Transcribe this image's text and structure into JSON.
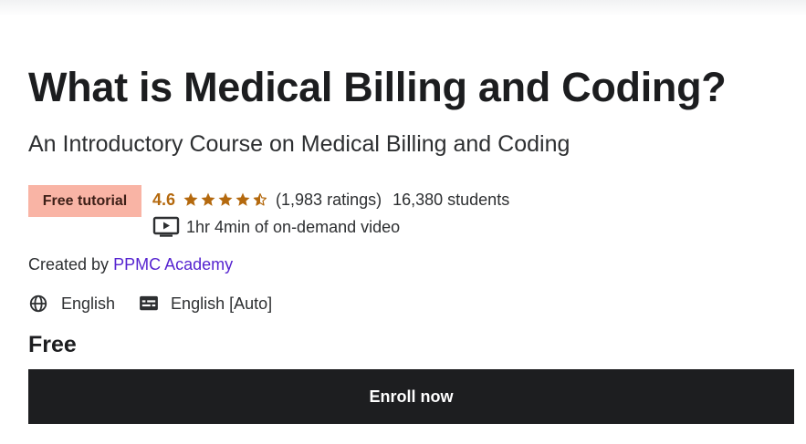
{
  "course": {
    "title": "What is Medical Billing and Coding?",
    "subtitle": "An Introductory Course on Medical Billing and Coding",
    "badge": "Free tutorial",
    "rating": "4.6",
    "rating_stars": 4.6,
    "ratings_count": "(1,983 ratings)",
    "students": "16,380 students",
    "video_length": "1hr 4min of on-demand video"
  },
  "creator": {
    "prefix": "Created by",
    "name": "PPMC Academy"
  },
  "languages": {
    "audio": "English",
    "captions": "English [Auto]"
  },
  "purchase": {
    "price": "Free",
    "enroll_label": "Enroll now"
  },
  "colors": {
    "accent_purple": "#5624d0",
    "rating_orange": "#b4690e",
    "badge_bg": "#f9b4a5",
    "button_bg": "#1d1e20"
  },
  "icons": [
    "star-icon",
    "star-half-icon",
    "video-icon",
    "globe-icon",
    "captions-icon"
  ]
}
